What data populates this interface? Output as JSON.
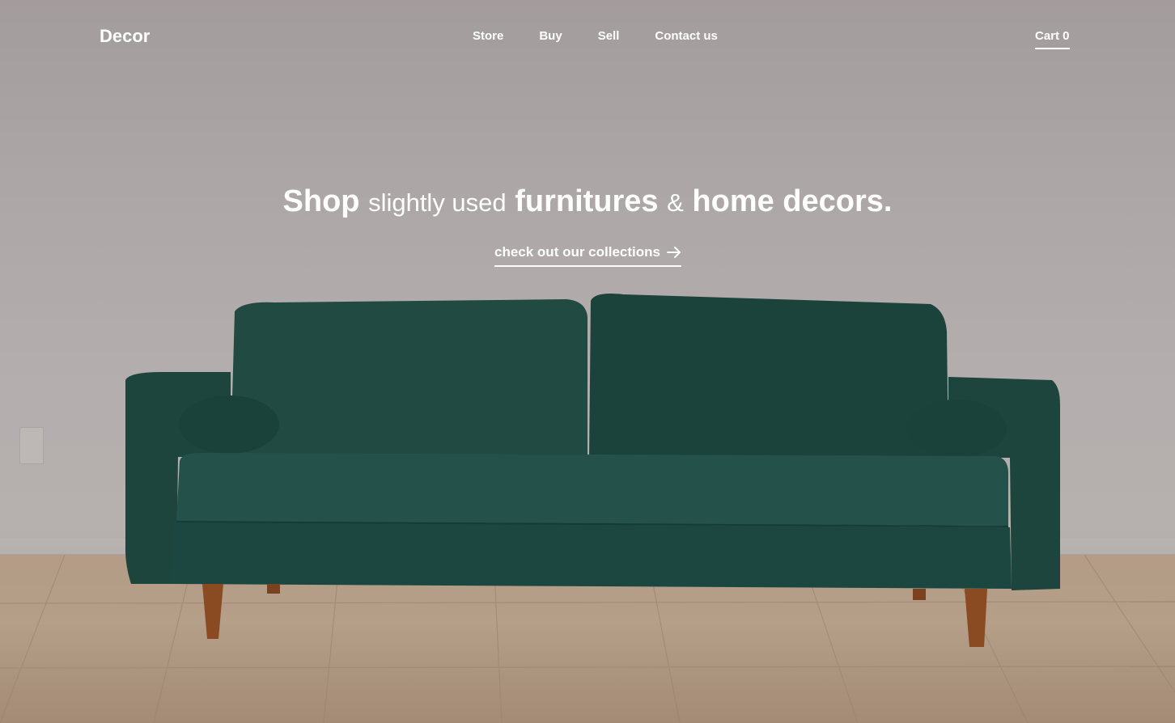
{
  "nav": {
    "brand": "Decor",
    "links": [
      "Store",
      "Buy",
      "Sell",
      "Contact us"
    ],
    "cart_label": "Cart 0"
  },
  "hero": {
    "headline": {
      "w1": "Shop",
      "w2": "slightly used",
      "w3": "furnitures",
      "w4": "&",
      "w5": "home decors."
    },
    "cta_label": "check out our collections",
    "cta_icon": "arrow-right-icon"
  },
  "colors": {
    "text": "#ffffff",
    "sofa": "#1f4a42",
    "wall": "#aca6a6",
    "floor": "#b59f89"
  }
}
